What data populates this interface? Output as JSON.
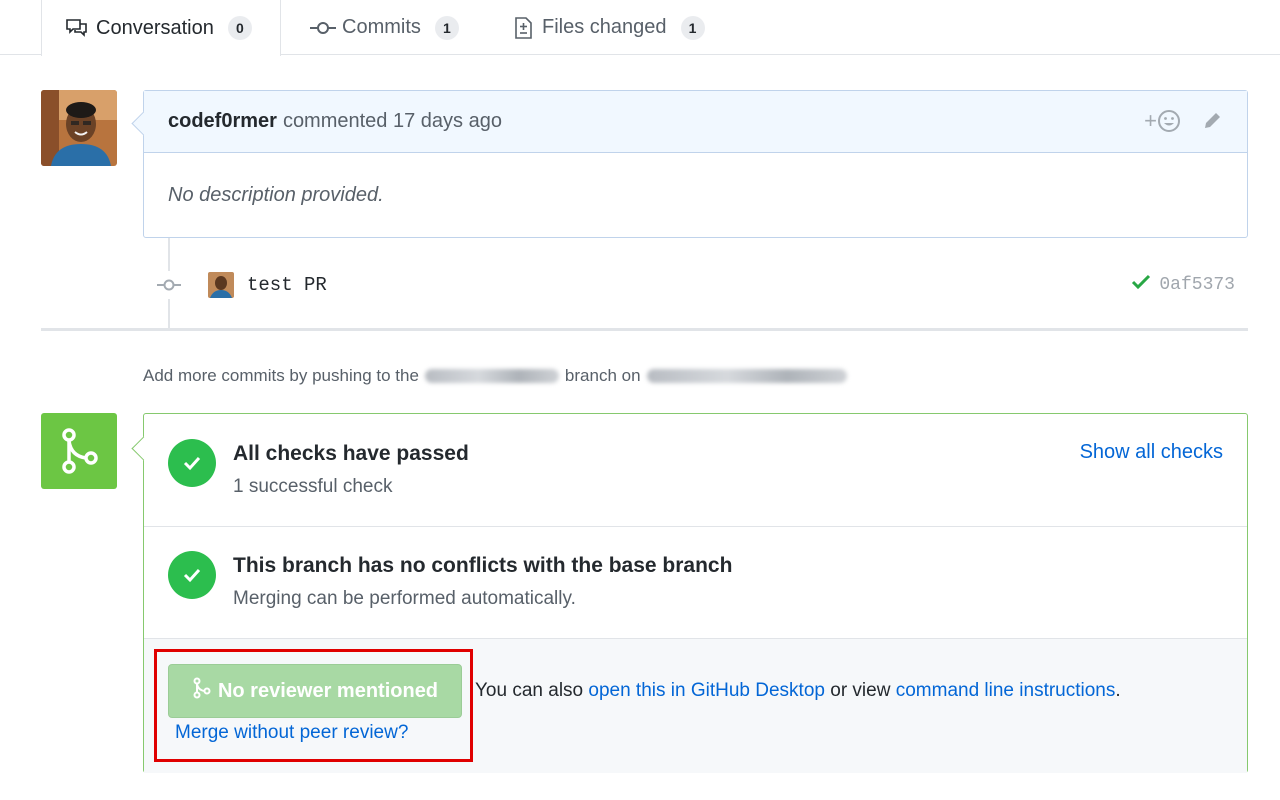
{
  "tabs": [
    {
      "label": "Conversation",
      "count": "0",
      "icon": "comment-discussion-icon",
      "selected": true
    },
    {
      "label": "Commits",
      "count": "1",
      "icon": "git-commit-icon"
    },
    {
      "label": "Files changed",
      "count": "1",
      "icon": "diff-icon"
    }
  ],
  "comment": {
    "author": "codef0rmer",
    "action": "commented 17 days ago",
    "body": "No description provided."
  },
  "commit": {
    "message": "test PR",
    "sha": "0af5373",
    "status": "success"
  },
  "push_note": {
    "prefix": "Add more commits by pushing to the",
    "middle": "branch on"
  },
  "merge": {
    "checks_title": "All checks have passed",
    "checks_sub": "1 successful check",
    "show_all_checks": "Show all checks",
    "conflicts_title": "This branch has no conflicts with the base branch",
    "conflicts_sub": "Merging can be performed automatically.",
    "button_label": "No reviewer mentioned",
    "merge_without": "Merge without peer review?",
    "also_prefix": "You can also",
    "desktop_link": "open this in GitHub Desktop",
    "or_view": "or view",
    "cli_link": "command line instructions",
    "period": "."
  },
  "colors": {
    "success": "#2cbe4e",
    "merge_green": "#6cc644",
    "link": "#0366d6",
    "highlight": "#e00000"
  }
}
